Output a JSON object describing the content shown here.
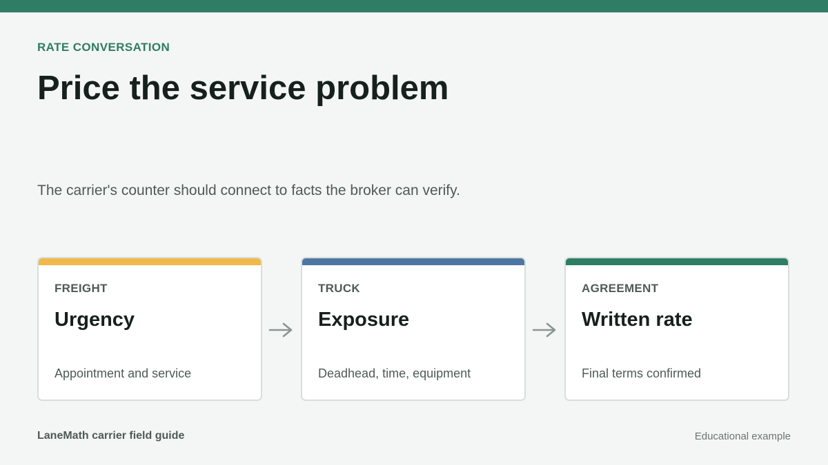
{
  "header": {
    "eyebrow": "RATE CONVERSATION",
    "title": "Price the service problem",
    "subtitle": "The carrier's counter should connect to facts the broker can verify."
  },
  "cards": [
    {
      "kicker": "FREIGHT",
      "heading": "Urgency",
      "description": "Appointment and service",
      "accent_color": "#f0b94a"
    },
    {
      "kicker": "TRUCK",
      "heading": "Exposure",
      "description": "Deadhead, time, equipment",
      "accent_color": "#4e76a2"
    },
    {
      "kicker": "AGREEMENT",
      "heading": "Written rate",
      "description": "Final terms confirmed",
      "accent_color": "#2e7d64"
    }
  ],
  "connector_icon": "arrow-right-icon",
  "footer": {
    "brand": "LaneMath carrier field guide",
    "note": "Educational example"
  },
  "colors": {
    "brand": "#2e7d64",
    "background": "#f4f6f5",
    "heading_text": "#16201d",
    "body_text": "#4f5a57",
    "arrow": "#8a9591"
  }
}
